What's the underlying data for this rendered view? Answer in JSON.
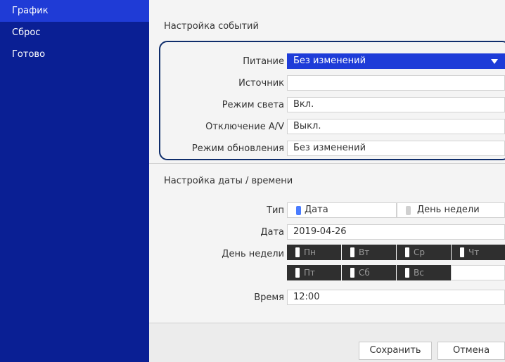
{
  "sidebar": {
    "items": [
      {
        "label": "График",
        "active": true
      },
      {
        "label": "Сброс",
        "active": false
      },
      {
        "label": "Готово",
        "active": false
      }
    ]
  },
  "event_settings": {
    "title": "Настройка событий",
    "rows": [
      {
        "label": "Питание",
        "value": "Без изменений",
        "selected": true
      },
      {
        "label": "Источник",
        "value": ""
      },
      {
        "label": "Режим света",
        "value": "Вкл."
      },
      {
        "label": "Отключение A/V",
        "value": "Выкл."
      },
      {
        "label": "Режим обновления",
        "value": "Без изменений"
      }
    ]
  },
  "datetime_settings": {
    "title": "Настройка даты / времени",
    "type_label": "Тип",
    "type_options": [
      {
        "label": "Дата",
        "selected": true
      },
      {
        "label": "День недели",
        "selected": false
      }
    ],
    "date_label": "Дата",
    "date_value": "2019-04-26",
    "weekday_label": "День недели",
    "weekdays": [
      "Пн",
      "Вт",
      "Ср",
      "Чт",
      "Пт",
      "Сб",
      "Вс"
    ],
    "time_label": "Время",
    "time_value": "12:00"
  },
  "buttons": {
    "save": "Сохранить",
    "cancel": "Отмена"
  },
  "colors": {
    "sidebar_bg": "#0a1f94",
    "sidebar_active": "#1f3bd6",
    "selected_blue": "#1e3cd8",
    "highlight_border": "#0f2d6b"
  }
}
